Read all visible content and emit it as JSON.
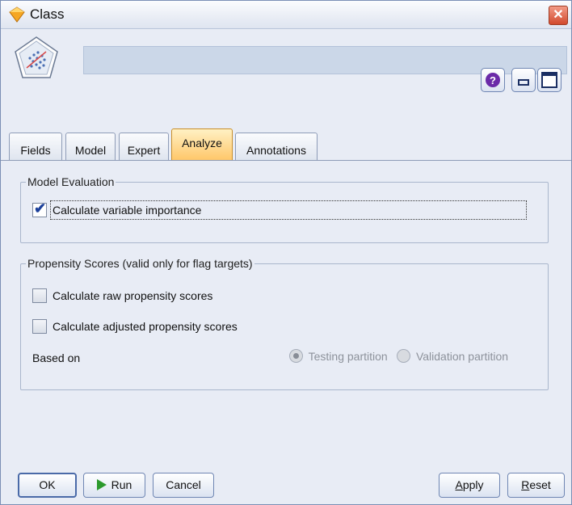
{
  "window": {
    "title": "Class",
    "close_glyph": "✕"
  },
  "header": {
    "node_icon": "classification-node-icon",
    "name_value": ""
  },
  "tabs": [
    {
      "label": "Fields"
    },
    {
      "label": "Model"
    },
    {
      "label": "Expert"
    },
    {
      "label": "Analyze",
      "active": true
    },
    {
      "label": "Annotations"
    }
  ],
  "model_evaluation": {
    "legend": "Model Evaluation",
    "calc_var_importance": {
      "label": "Calculate variable importance",
      "checked": true
    }
  },
  "propensity": {
    "legend": "Propensity Scores (valid only for flag targets)",
    "raw": {
      "label": "Calculate raw propensity scores",
      "checked": false
    },
    "adjusted": {
      "label": "Calculate adjusted propensity scores",
      "checked": false
    },
    "based_on_label": "Based on",
    "options": [
      {
        "label": "Testing partition",
        "selected": true,
        "enabled": false
      },
      {
        "label": "Validation partition",
        "selected": false,
        "enabled": false
      }
    ]
  },
  "buttons": {
    "ok": "OK",
    "run": "Run",
    "cancel": "Cancel",
    "apply_first": "A",
    "apply_rest": "pply",
    "reset_first": "R",
    "reset_rest": "eset"
  },
  "colors": {
    "active_tab": "#ffc76a",
    "accent": "#4a6aa8"
  }
}
